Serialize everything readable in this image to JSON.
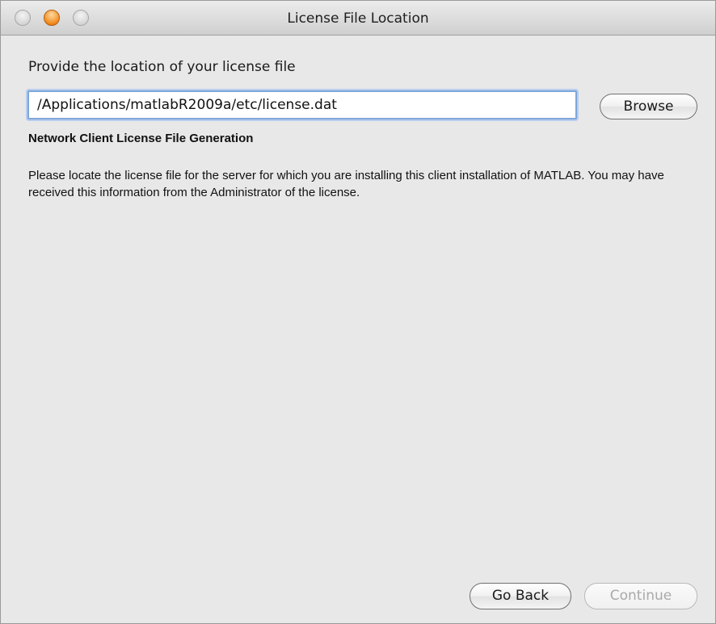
{
  "window": {
    "title": "License File Location"
  },
  "form": {
    "prompt": "Provide the location of your license file",
    "path_value": "/Applications/matlabR2009a/etc/license.dat",
    "browse_label": "Browse"
  },
  "info": {
    "heading": "Network Client License File Generation",
    "description": "Please locate the license file for the server for which you are installing this client installation of MATLAB. You may have received this information from the Administrator of the license."
  },
  "footer": {
    "back_label": "Go Back",
    "continue_label": "Continue",
    "continue_enabled": false
  },
  "icons": {
    "close": "close-icon",
    "minimize": "minimize-icon",
    "zoom": "zoom-icon"
  },
  "colors": {
    "minimize_button": "#f08a1c",
    "field_focus_ring": "#7fa6d9",
    "window_background": "#e8e8e8"
  }
}
